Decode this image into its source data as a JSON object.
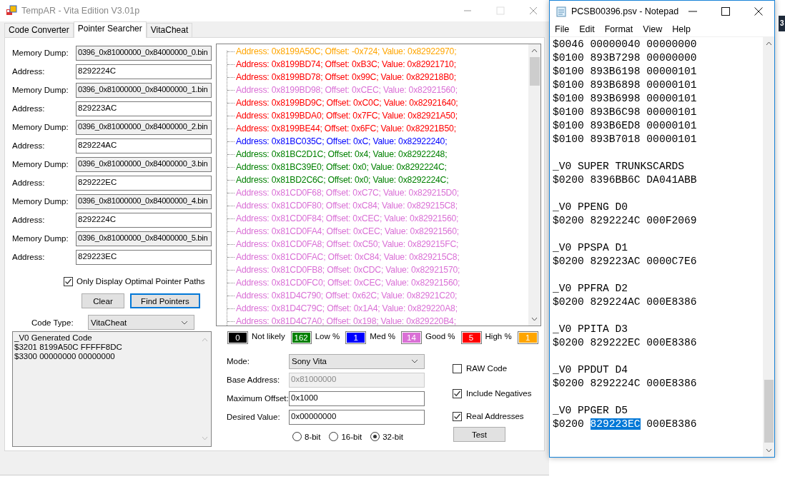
{
  "tempar_window": {
    "title": "TempAR - Vita Edition  V3.01p",
    "tabs": [
      {
        "label": "Code Converter",
        "selected": false
      },
      {
        "label": "Pointer Searcher",
        "selected": true
      },
      {
        "label": "VitaCheat",
        "selected": false
      }
    ],
    "dumps": [
      {
        "dump_label": "Memory Dump:",
        "dump_file": "0396_0x81000000_0x84000000_0.bin",
        "address_label": "Address:",
        "address": "8292224C"
      },
      {
        "dump_label": "Memory Dump:",
        "dump_file": "0396_0x81000000_0x84000000_1.bin",
        "address_label": "Address:",
        "address": "829223AC"
      },
      {
        "dump_label": "Memory Dump:",
        "dump_file": "0396_0x81000000_0x84000000_2.bin",
        "address_label": "Address:",
        "address": "829224AC"
      },
      {
        "dump_label": "Memory Dump:",
        "dump_file": "0396_0x81000000_0x84000000_3.bin",
        "address_label": "Address:",
        "address": "829222EC"
      },
      {
        "dump_label": "Memory Dump:",
        "dump_file": "0396_0x81000000_0x84000000_4.bin",
        "address_label": "Address:",
        "address": "8292224C"
      },
      {
        "dump_label": "Memory Dump:",
        "dump_file": "0396_0x81000000_0x84000000_5.bin",
        "address_label": "Address:",
        "address": "829223EC"
      }
    ],
    "optimal_checkbox": {
      "label": "Only Display Optimal  Pointer Paths",
      "checked": true
    },
    "buttons": [
      {
        "label": "Clear",
        "default": false
      },
      {
        "label": "Find Pointers",
        "default": true
      }
    ],
    "code_type": {
      "label": "Code Type:",
      "value": "VitaCheat"
    },
    "generated_code": [
      "_V0 Generated Code",
      "$3201 8199A50C FFFFF8DC",
      "$3300 00000000 00000000"
    ],
    "results": [
      {
        "text": "Address: 0x8199A50C; Offset: -0x724; Value: 0x82922970;",
        "color": "#ffa500"
      },
      {
        "text": "Address: 0x8199BD74; Offset: 0xB3C; Value: 0x82921710;",
        "color": "#ff0000"
      },
      {
        "text": "Address: 0x8199BD78; Offset: 0x99C; Value: 0x829218B0;",
        "color": "#ff0000"
      },
      {
        "text": "Address: 0x8199BD98; Offset: 0xCEC; Value: 0x82921560;",
        "color": "#da70d6"
      },
      {
        "text": "Address: 0x8199BD9C; Offset: 0xC0C; Value: 0x82921640;",
        "color": "#ff0000"
      },
      {
        "text": "Address: 0x8199BDA0; Offset: 0x7FC; Value: 0x82921A50;",
        "color": "#ff0000"
      },
      {
        "text": "Address: 0x8199BE44; Offset: 0x6FC; Value: 0x82921B50;",
        "color": "#ff0000"
      },
      {
        "text": "Address: 0x81BC035C; Offset: 0xC; Value: 0x82922240;",
        "color": "#0000ff"
      },
      {
        "text": "Address: 0x81BC2D1C; Offset: 0x4; Value: 0x82922248;",
        "color": "#008000"
      },
      {
        "text": "Address: 0x81BC39E0; Offset: 0x0; Value: 0x8292224C;",
        "color": "#008000"
      },
      {
        "text": "Address: 0x81BD2C6C; Offset: 0x0; Value: 0x8292224C;",
        "color": "#008000"
      },
      {
        "text": "Address: 0x81CD0F68; Offset: 0xC7C; Value: 0x829215D0;",
        "color": "#da70d6"
      },
      {
        "text": "Address: 0x81CD0F80; Offset: 0xC84; Value: 0x829215C8;",
        "color": "#da70d6"
      },
      {
        "text": "Address: 0x81CD0F84; Offset: 0xCEC; Value: 0x82921560;",
        "color": "#da70d6"
      },
      {
        "text": "Address: 0x81CD0FA4; Offset: 0xCEC; Value: 0x82921560;",
        "color": "#da70d6"
      },
      {
        "text": "Address: 0x81CD0FA8; Offset: 0xC50; Value: 0x829215FC;",
        "color": "#da70d6"
      },
      {
        "text": "Address: 0x81CD0FAC; Offset: 0xC84; Value: 0x829215C8;",
        "color": "#da70d6"
      },
      {
        "text": "Address: 0x81CD0FB8; Offset: 0xCDC; Value: 0x82921570;",
        "color": "#da70d6"
      },
      {
        "text": "Address: 0x81CD0FC0; Offset: 0xCEC; Value: 0x82921560;",
        "color": "#da70d6"
      },
      {
        "text": "Address: 0x81D4C790; Offset: 0x62C; Value: 0x82921C20;",
        "color": "#da70d6"
      },
      {
        "text": "Address: 0x81D4C79C; Offset: 0x1A4; Value: 0x829220A8;",
        "color": "#da70d6"
      },
      {
        "text": "Address: 0x81D4C7A0; Offset: 0x198; Value: 0x829220B4;",
        "color": "#da70d6"
      }
    ],
    "legend": [
      {
        "count": "0",
        "color": "#000000",
        "label": "Not likely"
      },
      {
        "count": "162",
        "color": "#008000",
        "label": "Low %"
      },
      {
        "count": "1",
        "color": "#0000ff",
        "label": "Med %"
      },
      {
        "count": "14",
        "color": "#da70d6",
        "label": "Good %"
      },
      {
        "count": "5",
        "color": "#ff0000",
        "label": "High %"
      },
      {
        "count": "1",
        "color": "#ffa500"
      }
    ],
    "fields": [
      {
        "kind": "dropdown",
        "label": "Mode:",
        "value": "Sony Vita"
      },
      {
        "kind": "text",
        "label": "Base Address:",
        "value": "0x81000000",
        "disabled": true
      },
      {
        "kind": "text",
        "label": "Maximum Offset:",
        "value": "0x1000",
        "disabled": false
      },
      {
        "kind": "text",
        "label": "Desired Value:",
        "value": "0x00000000",
        "disabled": false
      }
    ],
    "bit_size": [
      {
        "label": "8-bit",
        "selected": false
      },
      {
        "label": "16-bit",
        "selected": false
      },
      {
        "label": "32-bit",
        "selected": true
      }
    ],
    "options": [
      {
        "label": "RAW Code",
        "checked": false
      },
      {
        "label": "Include Negatives",
        "checked": true
      },
      {
        "label": "Real Addresses",
        "checked": true
      }
    ],
    "test_button": "Test"
  },
  "notepad_window": {
    "title": "PCSB00396.psv - Notepad",
    "menu": [
      "File",
      "Edit",
      "Format",
      "View",
      "Help"
    ],
    "blocks": [
      [
        {
          "text": "$0046 00000040 00000000"
        },
        {
          "text": "$0100 893B7298 00000000"
        },
        {
          "text": "$0100 893B6198 00000101"
        },
        {
          "text": "$0100 893B6898 00000101"
        },
        {
          "text": "$0100 893B6998 00000101"
        },
        {
          "text": "$0100 893B6C98 00000101"
        },
        {
          "text": "$0100 893B6ED8 00000101"
        },
        {
          "text": "$0100 893B7018 00000101"
        }
      ],
      [
        {
          "text": "_V0 SUPER TRUNKSCARDS"
        },
        {
          "text": "$0200 8396BB6C DA041ABB"
        }
      ],
      [
        {
          "text": "_V0 PPENG D0"
        },
        {
          "text": "$0200 8292224C 000F2069"
        }
      ],
      [
        {
          "text": "_V0 PPSPA D1"
        },
        {
          "text": "$0200 829223AC 0000C7E6"
        }
      ],
      [
        {
          "text": "_V0 PPFRA D2"
        },
        {
          "text": "$0200 829224AC 000E8386"
        }
      ],
      [
        {
          "text": "_V0 PPITA D3"
        },
        {
          "text": "$0200 829222EC 000E8386"
        }
      ],
      [
        {
          "text": "_V0 PPDUT D4"
        },
        {
          "text": "$0200 8292224C 000E8386"
        }
      ],
      [
        {
          "text": "_V0 PPGER D5"
        },
        {
          "text": "$0200 ",
          "selected": "829223EC",
          "after": " 000E8386"
        }
      ]
    ]
  },
  "edge_badge": "3"
}
